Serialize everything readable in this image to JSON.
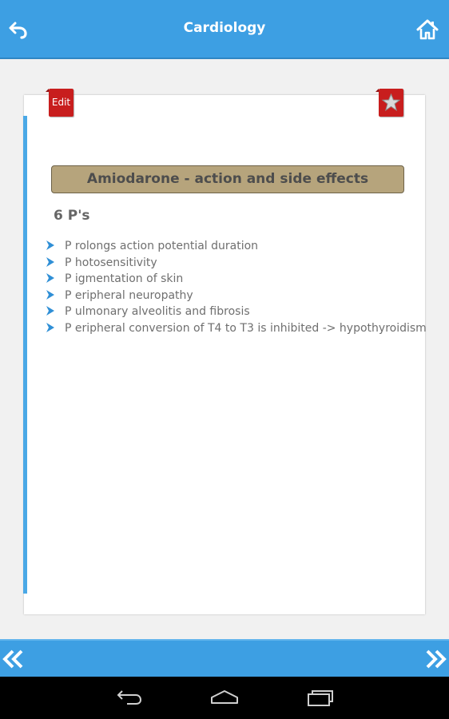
{
  "header": {
    "title": "Cardiology",
    "back_icon": "back-arrow-icon",
    "home_icon": "home-icon"
  },
  "card": {
    "edit_label": "Edit",
    "favorite_icon": "star-icon",
    "topic_title": "Amiodarone - action and side effects",
    "subheading": "6 P's",
    "points": [
      "P rolongs action potential duration",
      "P hotosensitivity",
      "P igmentation of skin",
      "P eripheral neuropathy",
      "P ulmonary alveolitis and fibrosis",
      "P eripheral conversion of T4 to T3 is inhibited -> hypothyroidism"
    ]
  },
  "bottom_nav": {
    "prev_icon": "double-chevron-left-icon",
    "next_icon": "double-chevron-right-icon"
  },
  "system_nav": {
    "back_icon": "system-back-icon",
    "home_icon": "system-home-icon",
    "recents_icon": "system-recents-icon"
  },
  "colors": {
    "accent_blue": "#3d9fe3",
    "title_bg": "#b6a47c",
    "tab_red": "#c81e1e",
    "bullet_blue": "#2f8fd6"
  }
}
